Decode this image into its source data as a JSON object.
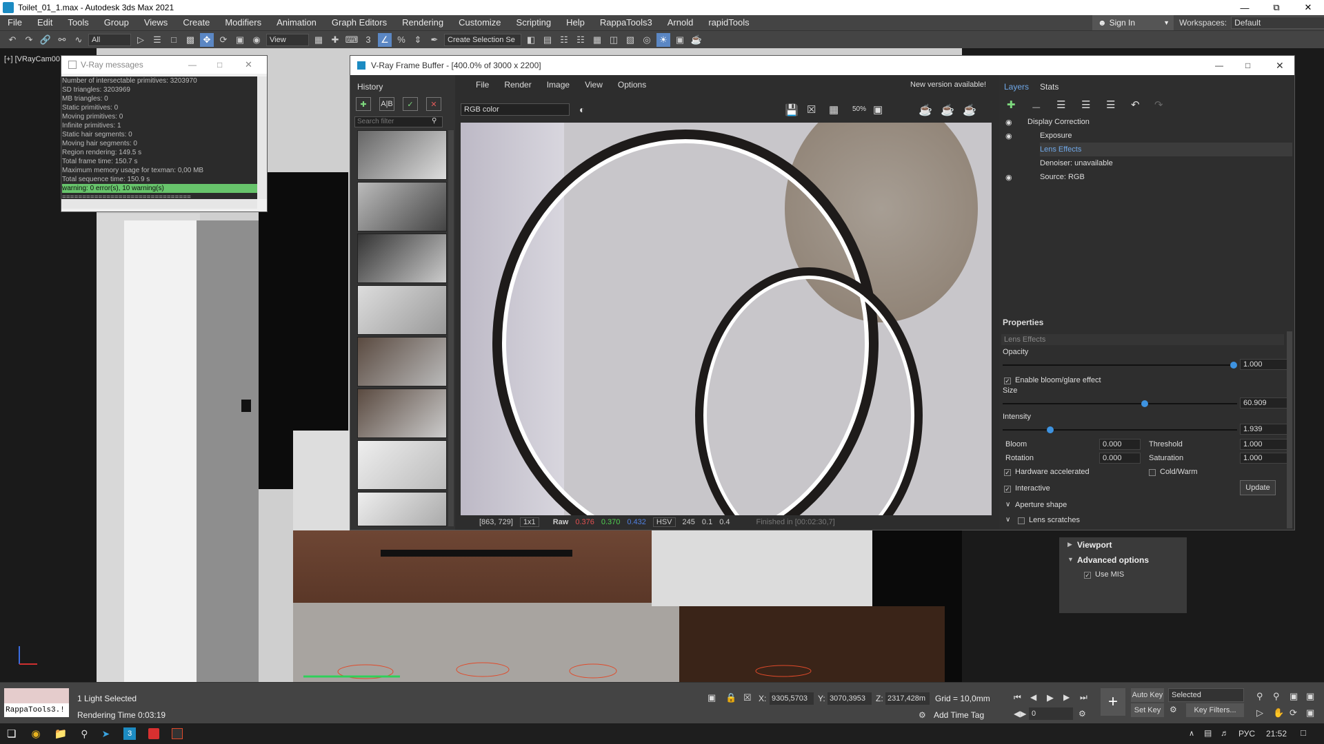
{
  "window": {
    "title": "Toilet_01_1.max - Autodesk 3ds Max 2021"
  },
  "menu": [
    "File",
    "Edit",
    "Tools",
    "Group",
    "Views",
    "Create",
    "Modifiers",
    "Animation",
    "Graph Editors",
    "Rendering",
    "Customize",
    "Scripting",
    "Help",
    "RappaTools3",
    "Arnold",
    "rapidTools"
  ],
  "signin": "Sign In",
  "workspaces": {
    "label": "Workspaces:",
    "value": "Default"
  },
  "toolbar": {
    "selection_filter": "All",
    "ref_coord": "View",
    "named_selection": "Create Selection Se"
  },
  "viewport": {
    "label": "[+] [VRayCam00"
  },
  "vray_messages": {
    "title": "V-Ray messages",
    "lines": [
      "Number of intersectable primitives: 3203970",
      "SD triangles: 3203969",
      "MB triangles: 0",
      "Static primitives: 0",
      "Moving primitives: 0",
      "Infinite primitives: 1",
      "Static hair segments: 0",
      "Moving hair segments: 0",
      "Region rendering: 149.5 s",
      "Total frame time: 150.7 s",
      "Maximum memory usage for texman: 0,00 MB",
      "Total sequence time: 150.9 s"
    ],
    "highlight": "warning: 0 error(s), 10 warning(s)",
    "separator": "================================"
  },
  "vfb": {
    "title": "V-Ray Frame Buffer - [400.0% of 3000 x 2200]",
    "menu": [
      "File",
      "Render",
      "Image",
      "View",
      "Options"
    ],
    "new_version": "New version available!",
    "channel": "RGB color",
    "zoom_btn": "50%",
    "history": {
      "title": "History",
      "search_placeholder": "Search filter"
    },
    "status": {
      "coords": "[863, 729]",
      "sample": "1x1",
      "mode": "Raw",
      "r": "0.376",
      "g": "0.370",
      "b": "0.432",
      "space": "HSV",
      "h": "245",
      "s": "0.1",
      "v": "0.4",
      "finished": "Finished in [00:02:30,7]"
    },
    "layers": {
      "tabs": [
        "Layers",
        "Stats"
      ],
      "items": [
        "Display Correction",
        "Exposure",
        "Lens Effects",
        "Denoiser: unavailable",
        "Source: RGB"
      ]
    },
    "properties": {
      "title": "Properties",
      "section": "Lens Effects",
      "opacity_label": "Opacity",
      "opacity": "1.000",
      "opacity_frac": 1.0,
      "enable_bloom": "Enable bloom/glare effect",
      "size_label": "Size",
      "size": "60.909",
      "size_frac": 0.61,
      "intensity_label": "Intensity",
      "intensity": "1.939",
      "intensity_frac": 0.194,
      "bloom_label": "Bloom",
      "bloom": "0.000",
      "threshold_label": "Threshold",
      "threshold": "1.000",
      "rotation_label": "Rotation",
      "rotation": "0.000",
      "saturation_label": "Saturation",
      "saturation": "1.000",
      "hw_accel": "Hardware accelerated",
      "coldwarm": "Cold/Warm",
      "interactive": "Interactive",
      "update": "Update",
      "aperture": "Aperture shape",
      "scratches": "Lens scratches"
    }
  },
  "right_panel": {
    "viewport": "Viewport",
    "advanced": "Advanced options",
    "use_mis": "Use MIS"
  },
  "status": {
    "script_field": "RappaTools3.!",
    "selected": "1 Light Selected",
    "render_time": "Rendering Time  0:03:19",
    "x": "9305,5703",
    "y": "3070,3953",
    "z": "2317,428m",
    "grid": "Grid = 10,0mm",
    "add_time_tag": "Add Time Tag",
    "auto_key": "Auto Key",
    "set_key": "Set Key",
    "key_mode": "Selected",
    "frame": "0",
    "key_filters": "Key Filters..."
  },
  "taskbar": {
    "lang": "РУС",
    "time": "21:52"
  },
  "colors": {
    "accent": "#5b87c4",
    "highlight": "#67c46b",
    "slider_knob": "#3e93e0"
  }
}
